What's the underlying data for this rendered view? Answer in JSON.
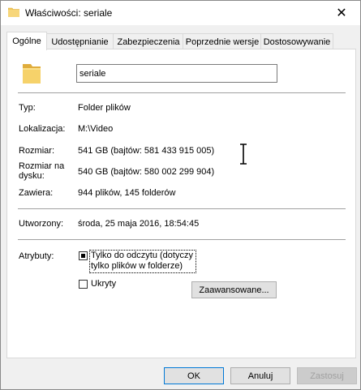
{
  "window": {
    "title": "Właściwości: seriale",
    "close_glyph": "✕"
  },
  "tabs": [
    {
      "label": "Ogólne",
      "active": true
    },
    {
      "label": "Udostępnianie",
      "active": false
    },
    {
      "label": "Zabezpieczenia",
      "active": false
    },
    {
      "label": "Poprzednie wersje",
      "active": false
    },
    {
      "label": "Dostosowywanie",
      "active": false
    }
  ],
  "general": {
    "folder_name": "seriale",
    "type_label": "Typ:",
    "type_value": "Folder plików",
    "location_label": "Lokalizacja:",
    "location_value": "M:\\Video",
    "size_label": "Rozmiar:",
    "size_value": "541 GB (bajtów: 581 433 915 005)",
    "disk_size_label_1": "Rozmiar na",
    "disk_size_label_2": "dysku:",
    "disk_size_value": "540 GB (bajtów: 580 002 299 904)",
    "contains_label": "Zawiera:",
    "contains_value": "944 plików, 145 folderów",
    "created_label": "Utworzony:",
    "created_value": "środa, 25 maja 2016, 18:54:45",
    "attributes_label": "Atrybuty:",
    "readonly_label_1": "Tylko do odczytu (dotyczy",
    "readonly_label_2": "tylko plików w folderze)",
    "readonly_state": "indeterminate",
    "hidden_label": "Ukryty",
    "hidden_state": "unchecked",
    "advanced_button": "Zaawansowane..."
  },
  "footer": {
    "ok": "OK",
    "cancel": "Anuluj",
    "apply": "Zastosuj"
  },
  "colors": {
    "folder": "#f2c85b",
    "accent": "#0078d7"
  }
}
